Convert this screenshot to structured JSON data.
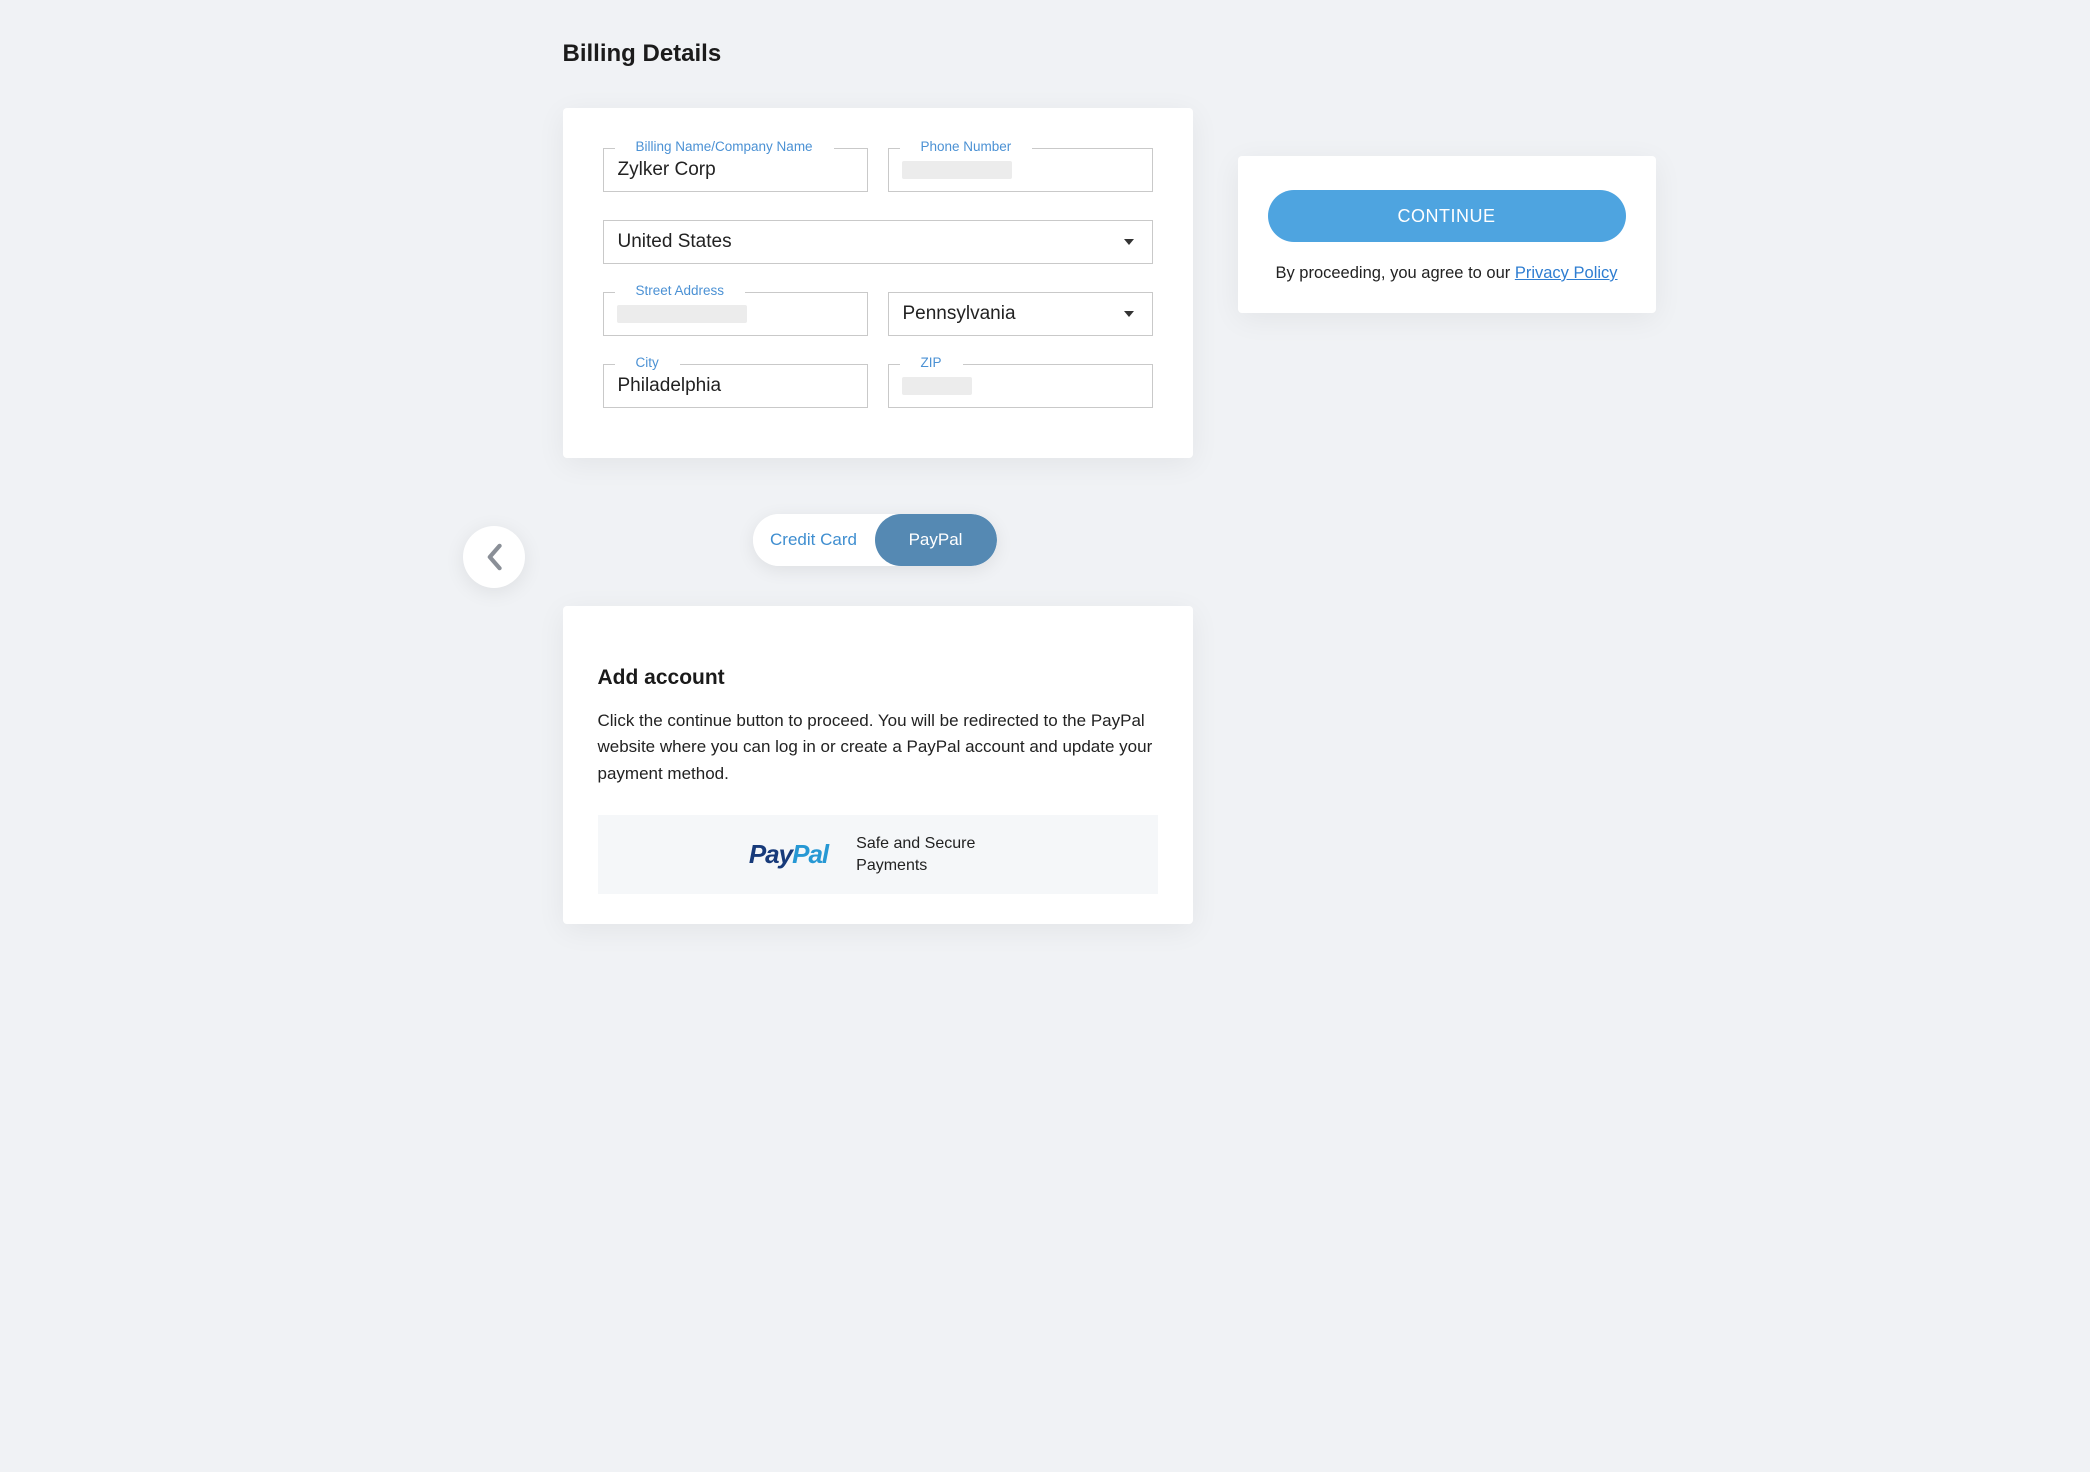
{
  "title": "Billing Details",
  "billing": {
    "name_label": "Billing Name/Company Name",
    "name_value": "Zylker Corp",
    "phone_label": "Phone Number",
    "phone_value": "",
    "country_value": "United States",
    "street_label": "Street Address",
    "street_value": "",
    "state_value": "Pennsylvania",
    "city_label": "City",
    "city_value": "Philadelphia",
    "zip_label": "ZIP",
    "zip_value": ""
  },
  "payment_tabs": {
    "credit": "Credit Card",
    "paypal": "PayPal",
    "active": "paypal"
  },
  "paypal_section": {
    "heading": "Add account",
    "description": "Click the continue button to proceed. You will be redirected to the PayPal website where you can log in or create a PayPal account and update your payment method.",
    "logo_part1": "Pay",
    "logo_part2": "Pal",
    "secure_text": "Safe and Secure Payments"
  },
  "sidebar": {
    "continue_label": "CONTINUE",
    "agree_prefix": "By proceeding, you agree to our ",
    "privacy_link": "Privacy Policy"
  }
}
